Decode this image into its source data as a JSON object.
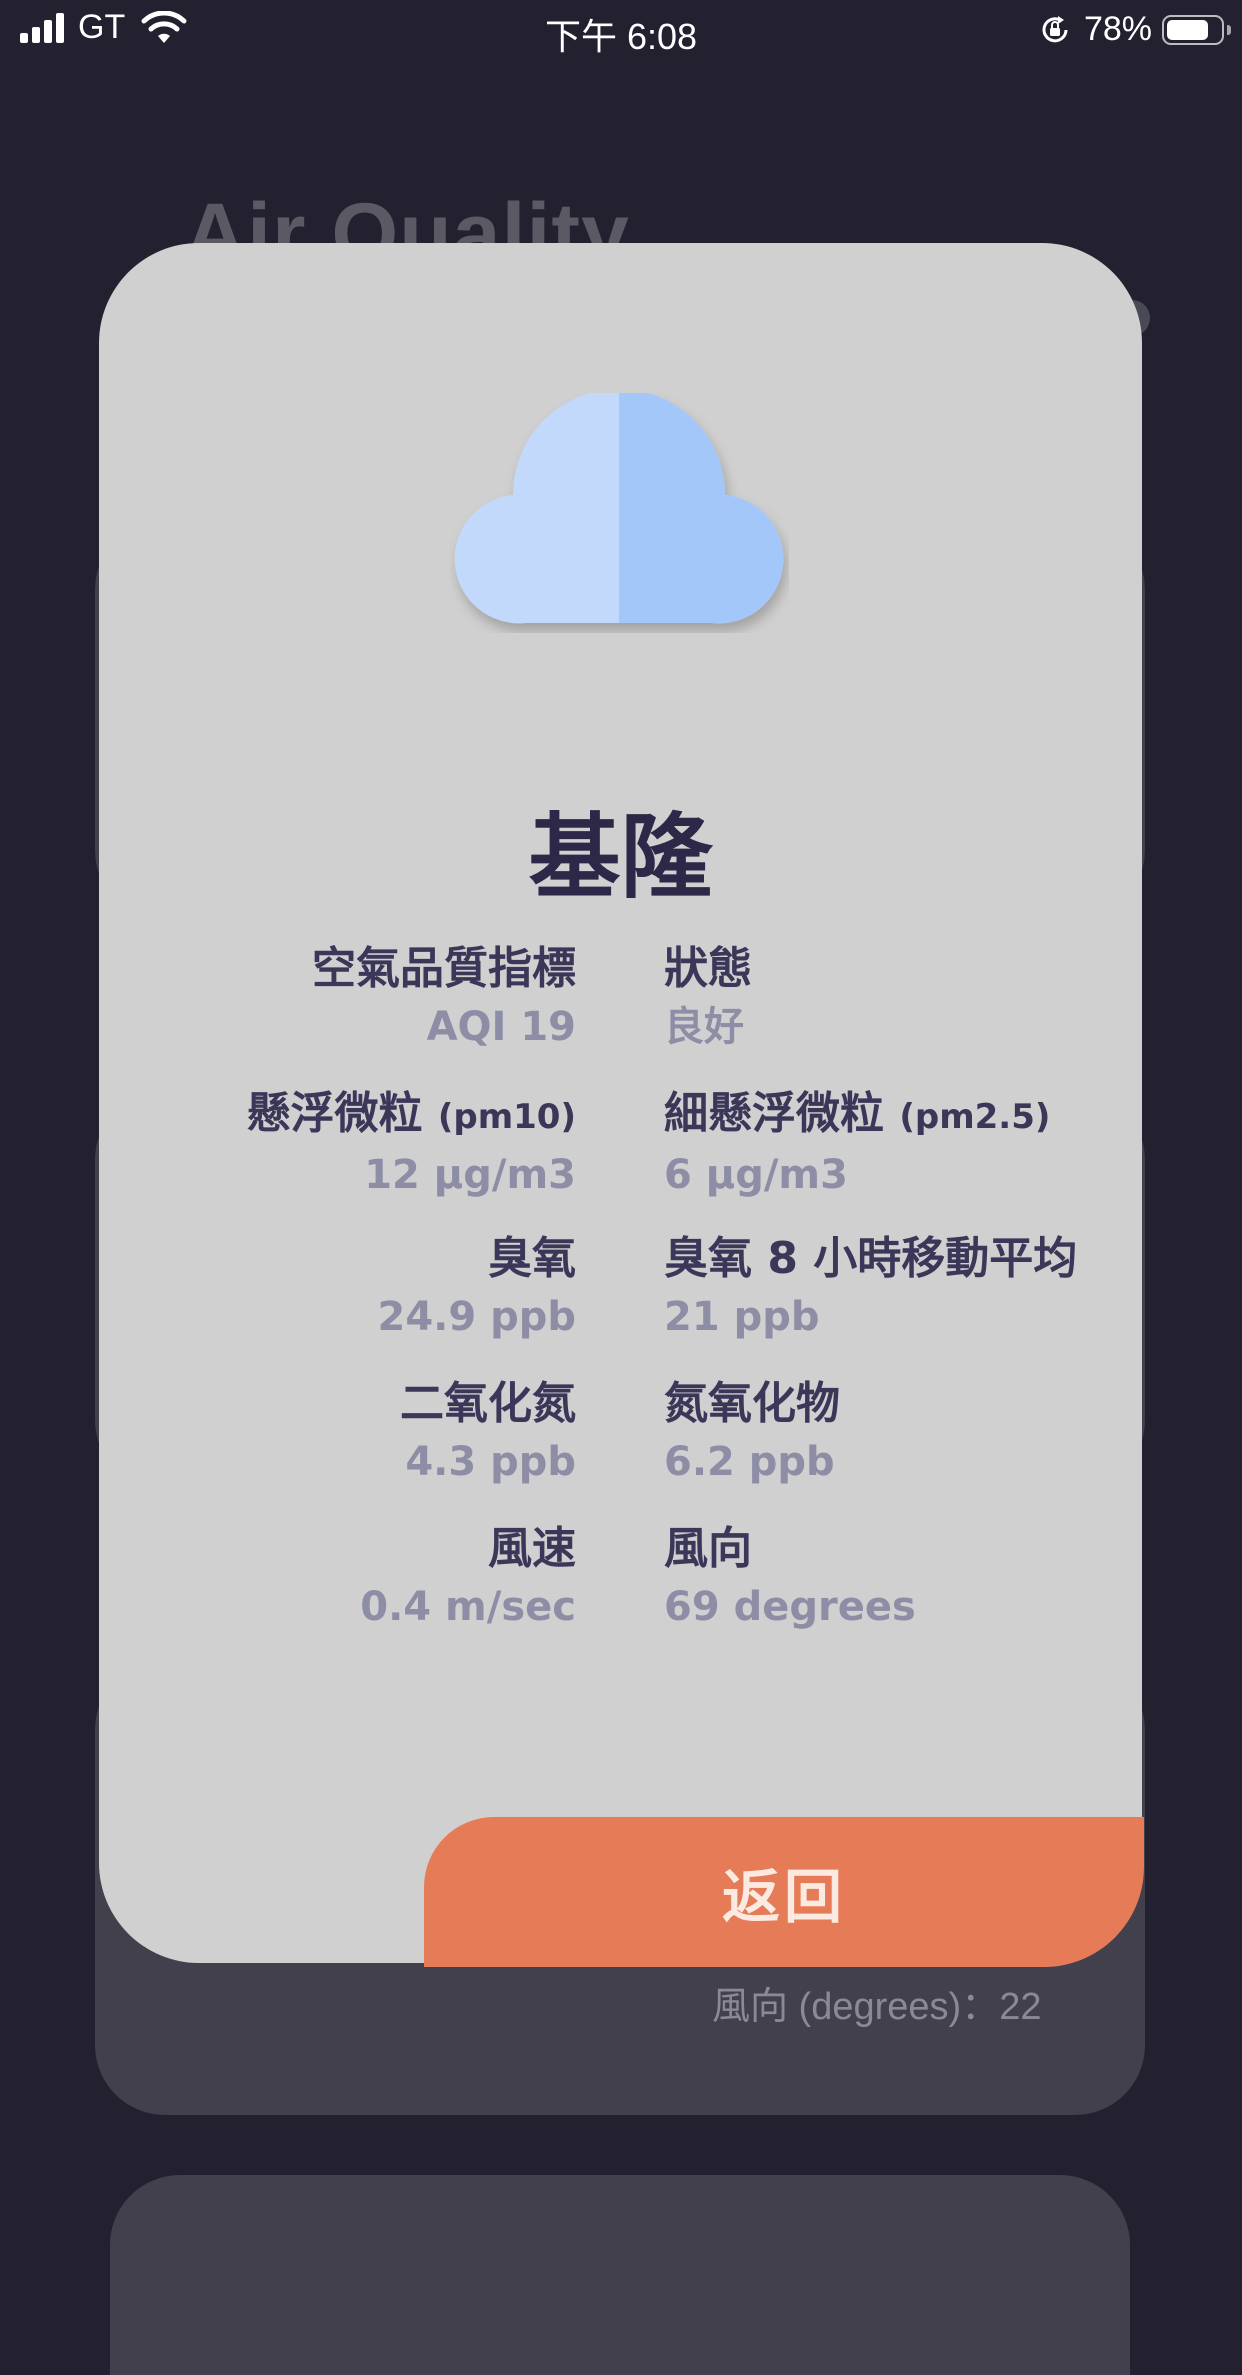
{
  "status_bar": {
    "carrier": "GT",
    "time": "下午 6:08",
    "battery_percent": "78%",
    "icons": [
      "signal-icon",
      "wifi-icon",
      "rotation-lock-icon",
      "battery-icon"
    ]
  },
  "background": {
    "title": "Air Quality",
    "wind_direction_text": "風向 (degrees)：22"
  },
  "modal": {
    "icon": "cloud-icon",
    "city": "基隆",
    "rows": [
      {
        "left_label": "空氣品質指標",
        "left_value": "AQI 19",
        "right_label": "狀態",
        "right_value": "良好"
      },
      {
        "left_label": "懸浮微粒",
        "left_label_unit": "(pm10)",
        "left_value": "12 µg/m3",
        "right_label": "細懸浮微粒",
        "right_label_unit": "(pm2.5)",
        "right_value": "6 µg/m3"
      },
      {
        "left_label": "臭氧",
        "left_value": "24.9 ppb",
        "right_label": "臭氧 8 小時移動平均",
        "right_value": "21 ppb"
      },
      {
        "left_label": "二氧化氮",
        "left_value": "4.3 ppb",
        "right_label": "氮氧化物",
        "right_value": "6.2 ppb"
      },
      {
        "left_label": "風速",
        "left_value": "0.4 m/sec",
        "right_label": "風向",
        "right_value": "69 degrees"
      }
    ],
    "back_label": "返回"
  },
  "colors": {
    "background": "#23212f",
    "modal": "#d0d0d0",
    "title": "#2d2848",
    "label": "#3b3758",
    "value": "#8e8da6",
    "accent": "#e57c57",
    "cloud_light": "#c2d9fb",
    "cloud_dark": "#a3c7f8"
  }
}
